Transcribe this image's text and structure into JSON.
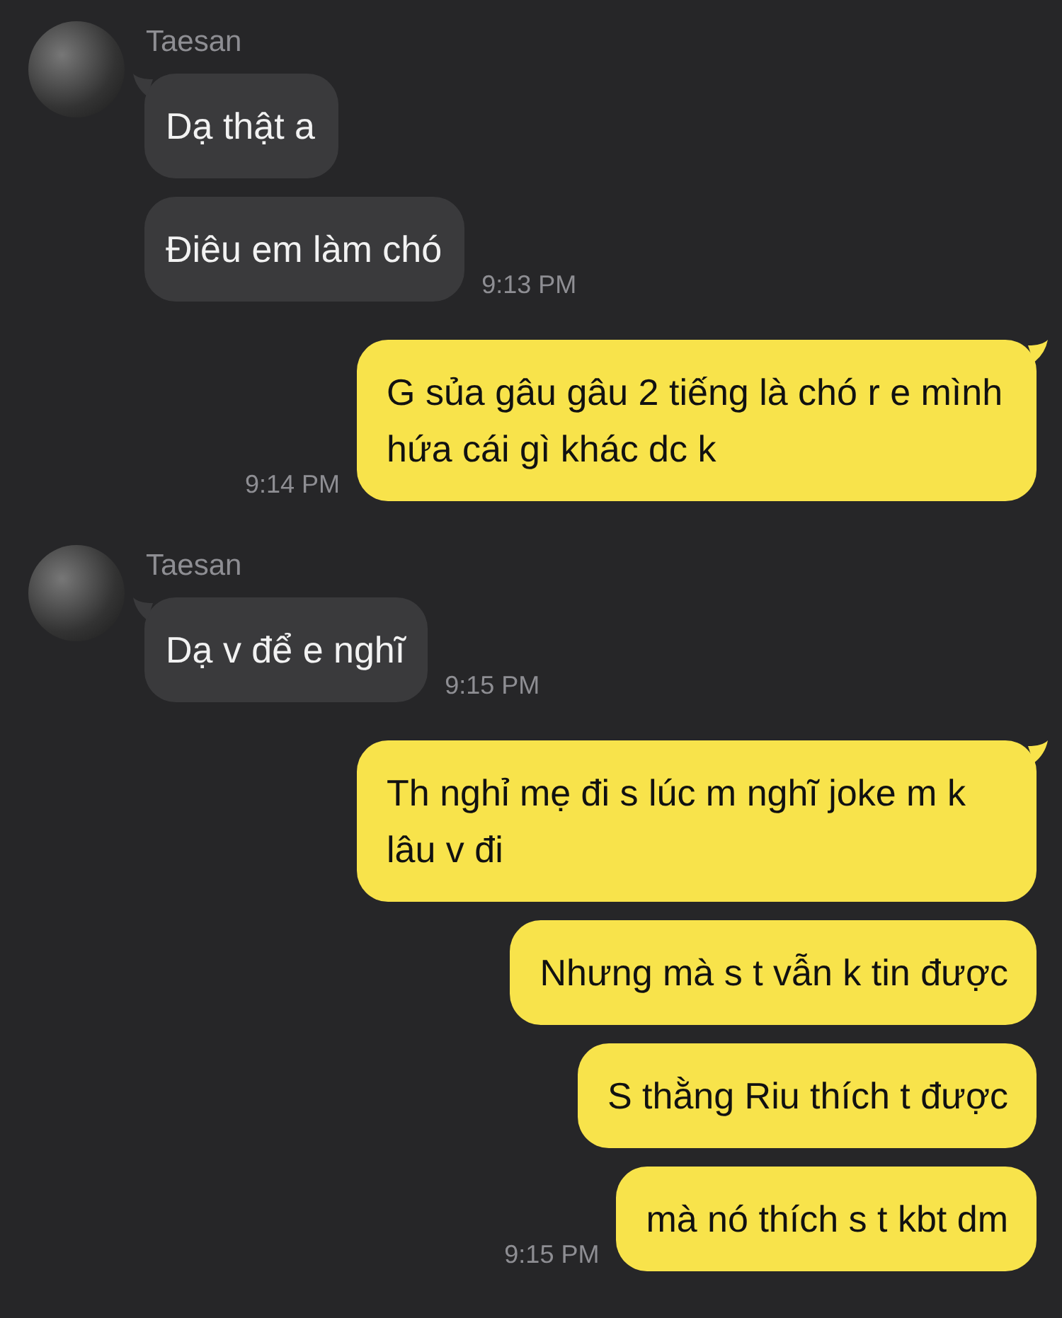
{
  "conversation": [
    {
      "kind": "incoming",
      "name": "Taesan",
      "messages": [
        "Dạ thật a",
        "Điêu em làm chó"
      ],
      "time": "9:13 PM"
    },
    {
      "kind": "outgoing",
      "messages": [
        "G sủa gâu gâu 2 tiếng là chó r e mình hứa cái gì khác dc k"
      ],
      "time": "9:14 PM"
    },
    {
      "kind": "incoming",
      "name": "Taesan",
      "messages": [
        "Dạ v để e nghĩ"
      ],
      "time": "9:15 PM"
    },
    {
      "kind": "outgoing",
      "messages": [
        "Th nghỉ mẹ đi s lúc m nghĩ joke m k lâu v đi",
        "Nhưng mà s t vẫn k tin được",
        "S thằng Riu thích t được",
        "mà nó thích s t kbt dm"
      ],
      "time": "9:15 PM"
    }
  ]
}
